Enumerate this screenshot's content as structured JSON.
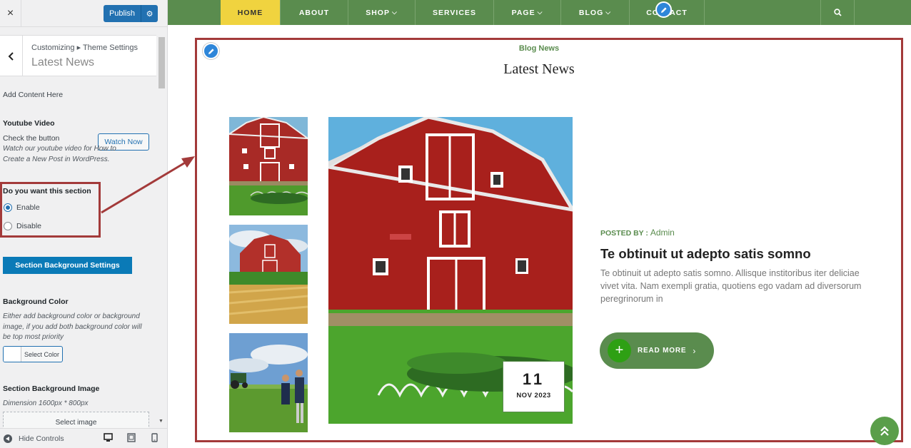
{
  "sidebar": {
    "close_icon": "×",
    "publish_label": "Publish",
    "gear_icon": "⚙",
    "back_icon": "‹",
    "breadcrumb": "Customizing ▸ Theme Settings",
    "title": "Latest News",
    "add_content": "Add Content Here",
    "youtube_heading": "Youtube Video",
    "check_button": "Check the button",
    "watch_now": "Watch Now",
    "youtube_desc": "Watch our youtube video for How to Create a New Post in WordPress.",
    "section_question": "Do you want this section",
    "enable_label": "Enable",
    "disable_label": "Disable",
    "enable_checked": true,
    "section_bg_button": "Section Background Settings",
    "bg_color_heading": "Background Color",
    "bg_color_desc": "Either add background color or background image, if you add both background color will be top most priority",
    "select_color": "Select Color",
    "bg_image_heading": "Section Background Image",
    "dimension": "Dimension 1600px * 800px",
    "select_image": "Select image",
    "hide_controls": "Hide Controls",
    "device_icons": [
      "desktop-icon",
      "tablet-icon",
      "mobile-icon"
    ]
  },
  "nav": {
    "items": [
      {
        "label": "HOME",
        "active": true
      },
      {
        "label": "ABOUT"
      },
      {
        "label": "SHOP",
        "dropdown": true
      },
      {
        "label": "SERVICES"
      },
      {
        "label": "PAGE",
        "dropdown": true
      },
      {
        "label": "BLOG",
        "dropdown": true
      },
      {
        "label": "CONTACT"
      }
    ],
    "chevron": "⌄",
    "search_icon": "search-icon",
    "edit_icon": "pencil-icon"
  },
  "section": {
    "subtitle": "Blog News",
    "title": "Latest News",
    "post": {
      "posted_by_label": "POSTED BY :",
      "author": "Admin",
      "title": "Te obtinuit ut adepto satis somno",
      "excerpt": "Te obtinuit ut adepto satis somno. Allisque institoribus iter deliciae vivet vita. Nam exempli gratia, quotiens ego vadam ad diversorum peregrinorum in",
      "read_more": "READ MORE",
      "read_more_plus": "+",
      "read_more_chevron": "›",
      "date_day": "11",
      "date_month": "NOV 2023"
    },
    "scroll_top_icon": "»"
  },
  "colors": {
    "nav_green": "#5a8c4e",
    "nav_active": "#f0d33f",
    "wp_blue": "#2271b1",
    "highlight_red": "#a33a3a",
    "read_more_plus": "#2ea014"
  }
}
